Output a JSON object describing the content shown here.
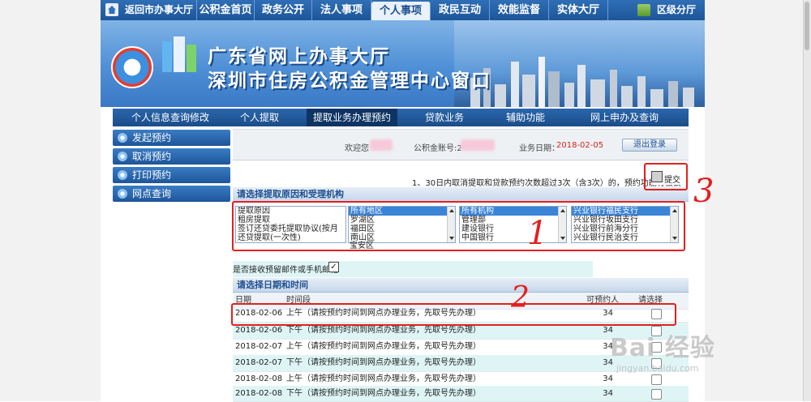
{
  "topnav": {
    "items": [
      "返回市办事大厅",
      "公积金首页",
      "政务公开",
      "法人事项",
      "个人事项",
      "政民互动",
      "效能监督",
      "实体大厅",
      "区级分厅"
    ],
    "active_index": 4
  },
  "banner": {
    "title_line1": "广东省网上办事大厅",
    "title_line2": "深圳市住房公积金管理中心窗口"
  },
  "subnav": {
    "items": [
      "个人信息查询修改",
      "个人提取",
      "提取业务办理预约",
      "贷款业务",
      "辅助功能",
      "网上申办及查询"
    ],
    "active_index": 2
  },
  "sidebar": {
    "items": [
      "发起预约",
      "取消预约",
      "打印预约",
      "网点查询"
    ]
  },
  "welcome": {
    "greeting": "欢迎您",
    "account_label": "公积金账号:2",
    "business_date_label": "业务日期：",
    "business_date": "2018-02-05",
    "logout": "退出登录"
  },
  "notice": "1、30日内取消提取和贷款预约次数超过3次（含3次）的，预约功能将被锁",
  "submit_label": "提交",
  "reason_section": {
    "title": "请选择提取原因和受理机构",
    "reasons": [
      "提取原因",
      "租房提取",
      "签订还贷委托提取协议(按月",
      "还贷提取(一次性)"
    ],
    "districts": [
      "所有地区",
      "罗湖区",
      "福田区",
      "南山区",
      "宝安区"
    ],
    "banks": [
      "所有机构",
      "管理部",
      "建设银行",
      "中国银行"
    ],
    "branches": [
      "兴业银行福民支行",
      "兴业银行坂田支行",
      "兴业银行前海分行",
      "兴业银行民治支行"
    ]
  },
  "email_option": {
    "label": "是否接收预留邮件或手机邮箱",
    "checked": true,
    "check_mark": "✓"
  },
  "time_section": {
    "title": "请选择日期和时间",
    "columns": [
      "日期",
      "时间段",
      "可预约人",
      "请选择"
    ],
    "rows": [
      {
        "date": "2018-02-06",
        "period": "上午（请按预约时间到网点办理业务，先取号先办理）",
        "available": "34"
      },
      {
        "date": "2018-02-06",
        "period": "下午（请按预约时间到网点办理业务，先取号先办理）",
        "available": "34"
      },
      {
        "date": "2018-02-07",
        "period": "上午（请按预约时间到网点办理业务，先取号先办理）",
        "available": "34"
      },
      {
        "date": "2018-02-07",
        "period": "下午（请按预约时间到网点办理业务，先取号先办理）",
        "available": "34"
      },
      {
        "date": "2018-02-08",
        "period": "上午（请按预约时间到网点办理业务，先取号先办理）",
        "available": "34"
      },
      {
        "date": "2018-02-08",
        "period": "下午（请按预约时间到网点办理业务，先取号先办理）",
        "available": "34"
      }
    ]
  },
  "annotations": {
    "step1": "1",
    "step2": "2",
    "step3": "3",
    "color": "#e41f1f"
  },
  "watermark": {
    "brand": "Bai 经验",
    "url": "jingyan.baidu.com"
  }
}
